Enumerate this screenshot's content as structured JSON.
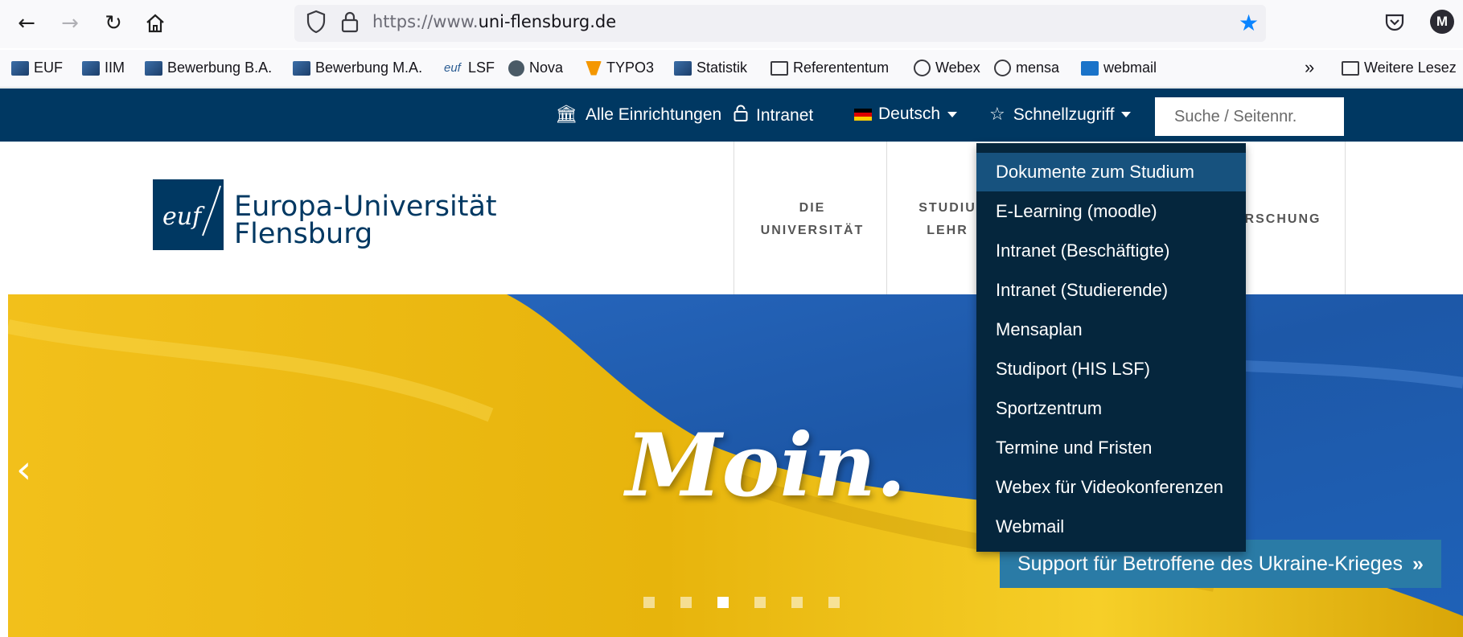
{
  "browser": {
    "url_prefix": "https://www.",
    "url_domain": "uni-flensburg.de",
    "account_initial": "M",
    "bookmarks": [
      "EUF",
      "IIM",
      "Bewerbung B.A.",
      "Bewerbung M.A.",
      "LSF",
      "Nova",
      "TYPO3",
      "Statistik",
      "Referententum",
      "Webex",
      "mensa",
      "webmail"
    ],
    "bookmarks_overflow": "Weitere Lesez"
  },
  "topnav": {
    "alle": "Alle Einrichtungen",
    "intranet": "Intranet",
    "language": "Deutsch",
    "schnell": "Schnellzugriff",
    "search_placeholder": "Suche / Seitennr."
  },
  "logo": {
    "mark": "euf",
    "line1": "Europa-Universität",
    "line2": "Flensburg"
  },
  "mainnav": {
    "item1_line1": "DIE",
    "item1_line2": "UNIVERSITÄT",
    "item2_line1": "STUDIU",
    "item2_line2": "LEHR",
    "item3": "RSCHUNG"
  },
  "dropdown": {
    "highlighted_index": 0,
    "items": [
      "Dokumente zum Studium",
      "E-Learning (moodle)",
      "Intranet (Beschäftigte)",
      "Intranet (Studierende)",
      "Mensaplan",
      "Studiport (HIS LSF)",
      "Sportzentrum",
      "Termine und Fristen",
      "Webex für Videokonferenzen",
      "Webmail"
    ]
  },
  "hero": {
    "headline": "Moin.",
    "support_label": "Support für Betroffene des Ukraine-Krieges",
    "support_arrow": "»",
    "slides_total": 6,
    "slide_active": 3
  },
  "colors": {
    "nav_bg": "#003862",
    "dropdown_bg": "#05263d",
    "dropdown_highlight": "#17527e",
    "support_bg": "#2a7ba6",
    "flag_blue": "#1f62b8",
    "flag_yellow": "#f6c414"
  }
}
